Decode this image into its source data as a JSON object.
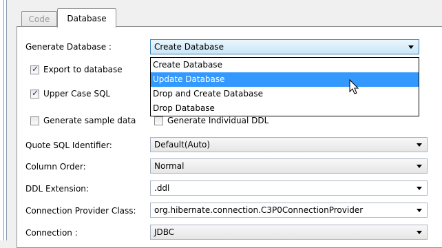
{
  "tabs": [
    {
      "label": "Code"
    },
    {
      "label": "Database"
    }
  ],
  "fields": {
    "generate_db": {
      "label": "Generate Database :",
      "value": "Create Database"
    },
    "quote_sql": {
      "label": "Quote SQL Identifier:",
      "value": "Default(Auto)"
    },
    "column_order": {
      "label": "Column Order:",
      "value": "Normal"
    },
    "ddl_ext": {
      "label": "DDL Extension:",
      "value": ".ddl"
    },
    "conn_provider": {
      "label": "Connection Provider Class:",
      "value": "org.hibernate.connection.C3P0ConnectionProvider"
    },
    "connection": {
      "label": "Connection :",
      "value": "JDBC"
    }
  },
  "checkboxes": {
    "export_db": {
      "label": "Export to database",
      "checked": true
    },
    "upper_case": {
      "label": "Upper Case SQL",
      "checked": true
    },
    "sample_data": {
      "label": "Generate sample data",
      "checked": false
    },
    "individual_ddl": {
      "label": "Generate Individual DDL",
      "checked": false
    }
  },
  "dropdown_options": [
    "Create Database",
    "Update Database",
    "Drop and Create Database",
    "Drop Database"
  ],
  "highlighted_option": "Update Database",
  "icons": [
    "chevron-down-icon",
    "checkmark-icon",
    "mouse-pointer-icon"
  ]
}
